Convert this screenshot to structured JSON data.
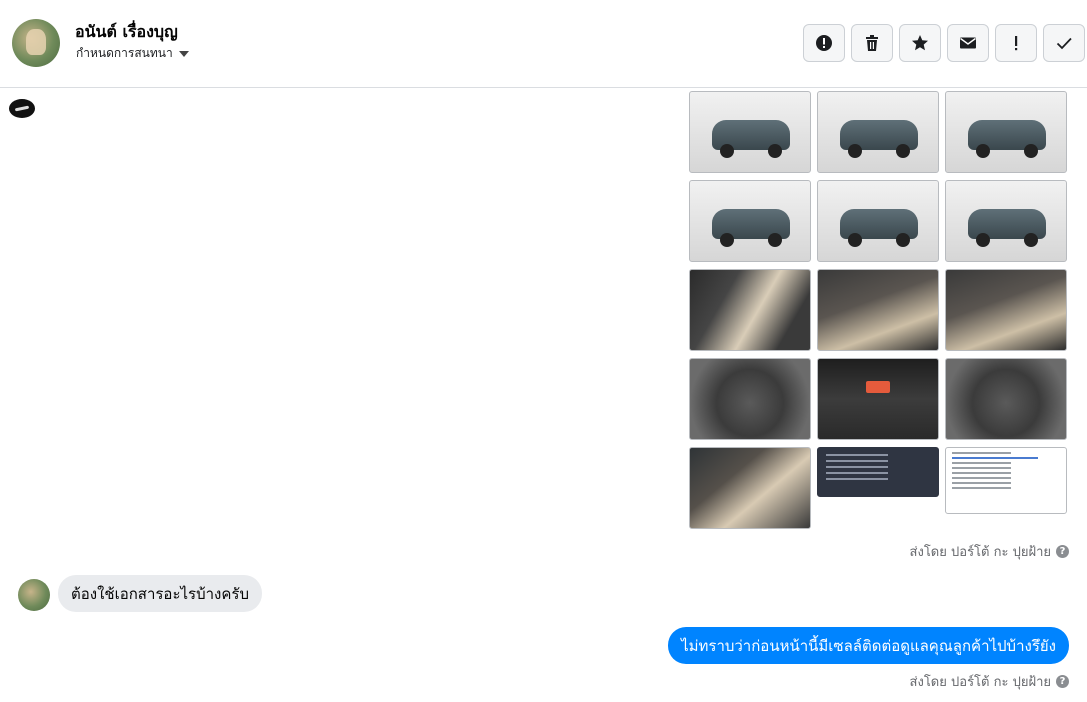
{
  "header": {
    "contact_name": "อนันต์ เรื่องบุญ",
    "conversation_setting": "กำหนดการสนทนา",
    "toolbar": [
      {
        "name": "spam-button",
        "icon": "alert-circle-icon"
      },
      {
        "name": "delete-button",
        "icon": "trash-icon"
      },
      {
        "name": "star-button",
        "icon": "star-icon"
      },
      {
        "name": "mark-unread-button",
        "icon": "envelope-icon"
      },
      {
        "name": "follow-up-button",
        "icon": "exclamation-icon"
      },
      {
        "name": "done-button",
        "icon": "check-icon"
      }
    ]
  },
  "messages": {
    "photo_grid": {
      "photos": [
        "car-front-photo",
        "car-front-angle-photo",
        "car-rear-angle-photo",
        "car-rear-photo",
        "car-side-photo",
        "car-side-angle-photo",
        "door-interior-photo",
        "dashboard-interior-photo",
        "gear-shift-photo",
        "engine-bay-photo",
        "center-console-photo",
        "engine-detail-photo",
        "rear-seat-photo",
        "spec-sheet-dark-photo",
        "spec-sheet-light-photo"
      ],
      "sent_by": "ส่งโดย ปอร์โต้ กะ ปุยฝ้าย"
    },
    "incoming": {
      "text": "ต้องใช้เอกสารอะไรบ้างครับ"
    },
    "outgoing": {
      "text": "ไม่ทราบว่าก่อนหน้านี้มีเซลล์ติดต่อดูแลคุณลูกค้าไปบ้างรึยัง",
      "sent_by": "ส่งโดย ปอร์โต้ กะ ปุยฝ้าย"
    }
  },
  "colors": {
    "outgoing_bubble": "#0084ff",
    "incoming_bubble": "#e9ebee",
    "secondary_text": "#65676b"
  }
}
